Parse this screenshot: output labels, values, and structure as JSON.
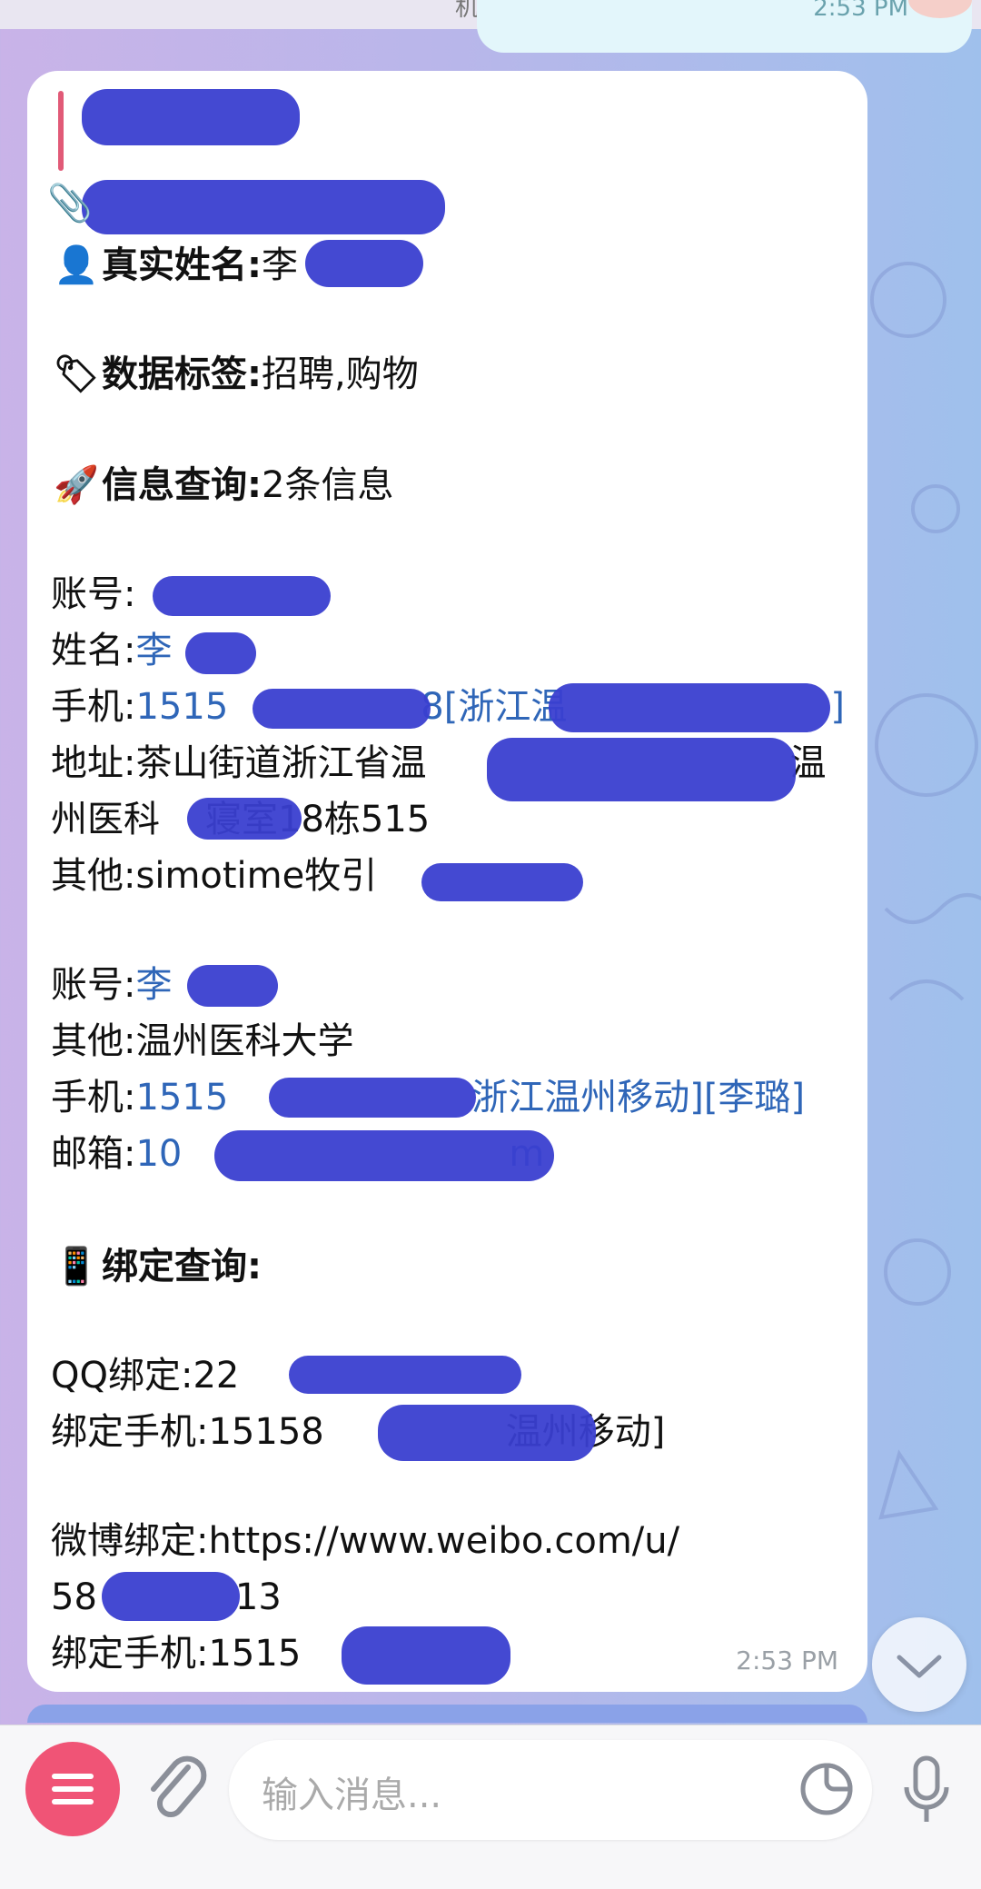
{
  "top": {
    "title": "机器人",
    "prev_time": "2:53 PM"
  },
  "message": {
    "real_name": {
      "icon": "person-icon",
      "label": "真实姓名:",
      "value": "李"
    },
    "tags": {
      "icon": "tag-icon",
      "label": "数据标签:",
      "value": "招聘,购物"
    },
    "info": {
      "icon": "rocket-icon",
      "label": "信息查询:",
      "value": "2条信息"
    },
    "record1": {
      "account_label": "账号:",
      "account_value": "",
      "name_label": "姓名:",
      "name_value": "李",
      "phone_label": "手机:",
      "phone_value_a": "1515",
      "phone_value_b": "8[浙江温",
      "phone_value_c": "]",
      "address_label": "地址:",
      "address_value_a": "茶山街道浙江省温",
      "address_value_b": "温",
      "address_line2_a": "州医科",
      "address_line2_b": "寝室18栋515",
      "other_label": "其他:",
      "other_value": "simotime牧引"
    },
    "record2": {
      "account_label": "账号:",
      "account_value": "李",
      "other_label": "其他:",
      "other_value": "温州医科大学",
      "phone_label": "手机:",
      "phone_value_a": "1515",
      "phone_value_b": "浙江温州移动][李璐]",
      "email_label": "邮箱:",
      "email_value_a": "10",
      "email_value_b": "m"
    },
    "binding": {
      "icon": "phone-icon",
      "label": "绑定查询:"
    },
    "qq": {
      "label": "QQ绑定:",
      "value": "22",
      "phone_label": "绑定手机:",
      "phone_value_a": "15158",
      "phone_value_b": "温州移动]"
    },
    "weibo": {
      "label": "微博绑定:",
      "url": "https://www.weibo.com/u/",
      "id_a": "58",
      "id_b": "13",
      "phone_label": "绑定手机:",
      "phone_value": "1515"
    },
    "time": "2:53 PM"
  },
  "composer": {
    "placeholder": "输入消息..."
  },
  "colors": {
    "link": "#2f66b8",
    "redaction": "#3a3fd0",
    "menu_button": "#f05476"
  }
}
